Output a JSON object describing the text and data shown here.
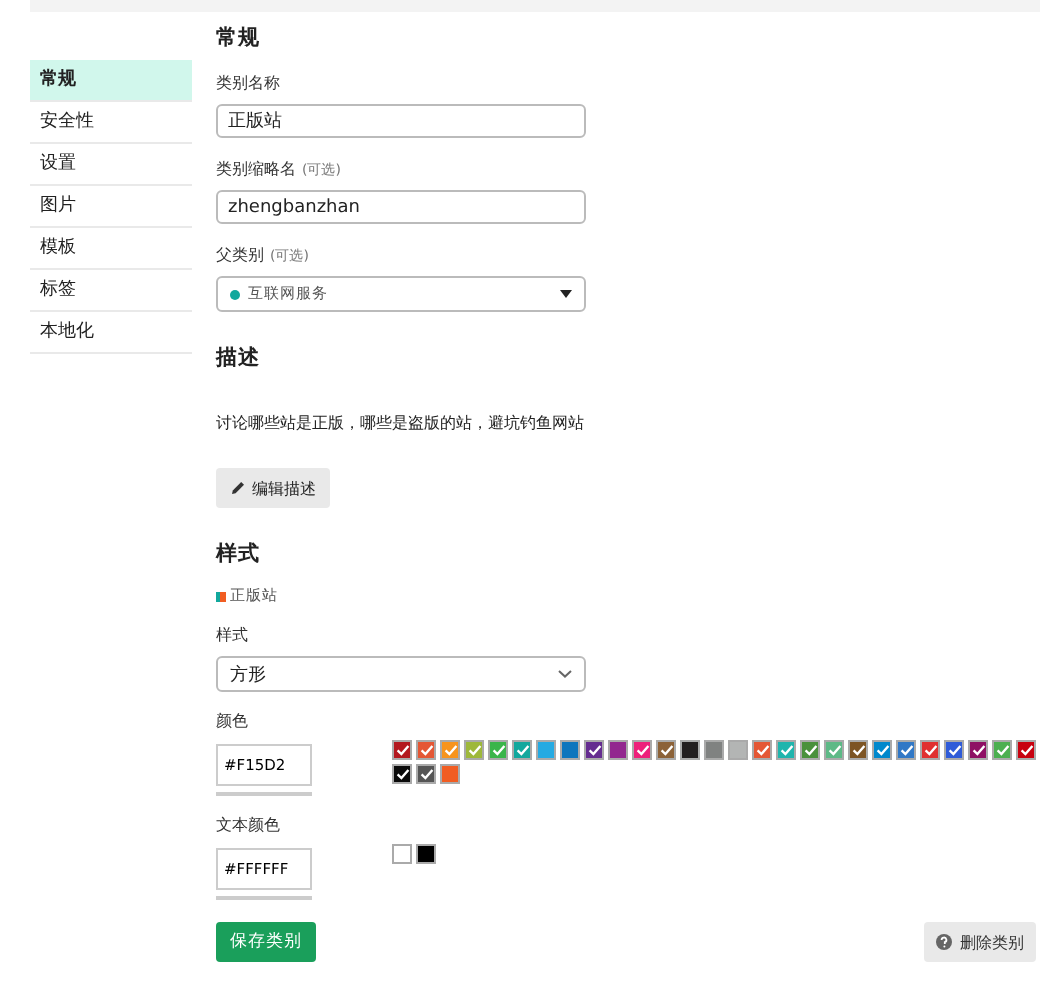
{
  "sidebar": {
    "items": [
      {
        "label": "常规",
        "selected": true
      },
      {
        "label": "安全性",
        "selected": false
      },
      {
        "label": "设置",
        "selected": false
      },
      {
        "label": "图片",
        "selected": false
      },
      {
        "label": "模板",
        "selected": false
      },
      {
        "label": "标签",
        "selected": false
      },
      {
        "label": "本地化",
        "selected": false
      }
    ]
  },
  "general": {
    "heading": "常规",
    "name": {
      "label": "类别名称",
      "value": "正版站"
    },
    "slug": {
      "label": "类别缩略名",
      "optional": "(可选)",
      "value": "zhengbanzhan"
    },
    "parent": {
      "label": "父类别",
      "optional": "(可选)",
      "value": "互联网服务"
    }
  },
  "description": {
    "heading": "描述",
    "text": "讨论哪些站是正版，哪些是盗版的站，避坑钓鱼网站",
    "edit_button": "编辑描述"
  },
  "style": {
    "heading": "样式",
    "preview": "正版站",
    "style_label": "样式",
    "style_value": "方形",
    "color_label": "颜色",
    "color_value": "#F15D2",
    "text_color_label": "文本颜色",
    "text_color_value": "#FFFFFF",
    "colors": [
      {
        "color": "#b3181f",
        "checked": true
      },
      {
        "color": "#e45735",
        "checked": true
      },
      {
        "color": "#f7941d",
        "checked": true
      },
      {
        "color": "#9eb83b",
        "checked": true
      },
      {
        "color": "#3ab54a",
        "checked": true
      },
      {
        "color": "#12a89d",
        "checked": true
      },
      {
        "color": "#25aae2",
        "checked": false
      },
      {
        "color": "#0e76bd",
        "checked": false
      },
      {
        "color": "#652d90",
        "checked": true
      },
      {
        "color": "#92278f",
        "checked": false
      },
      {
        "color": "#ed207b",
        "checked": true
      },
      {
        "color": "#8c6238",
        "checked": true
      },
      {
        "color": "#231f20",
        "checked": false
      },
      {
        "color": "#808281",
        "checked": false
      },
      {
        "color": "#b3b5b4",
        "checked": false
      },
      {
        "color": "#e45735",
        "checked": true
      },
      {
        "color": "#1fb5ad",
        "checked": true
      },
      {
        "color": "#4a913c",
        "checked": true
      },
      {
        "color": "#5db986",
        "checked": true
      },
      {
        "color": "#7d5423",
        "checked": true
      },
      {
        "color": "#0088cc",
        "checked": true
      },
      {
        "color": "#3178c6",
        "checked": true
      },
      {
        "color": "#e03131",
        "checked": true
      },
      {
        "color": "#2f5bd8",
        "checked": true
      },
      {
        "color": "#8e1064",
        "checked": true
      },
      {
        "color": "#4caf50",
        "checked": true
      },
      {
        "color": "#c8010f",
        "checked": true
      },
      {
        "color": "#0a0a0a",
        "checked": true
      },
      {
        "color": "#555555",
        "checked": true
      },
      {
        "color": "#f15d22",
        "checked": false
      }
    ],
    "text_colors": [
      {
        "color": "#ffffff"
      },
      {
        "color": "#000000"
      }
    ]
  },
  "buttons": {
    "save": "保存类别",
    "delete": "删除类别"
  }
}
